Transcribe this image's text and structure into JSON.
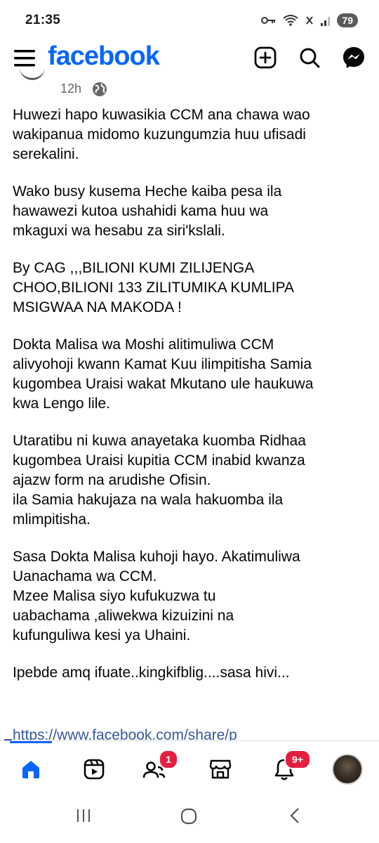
{
  "status_bar": {
    "time": "21:35",
    "battery": "79"
  },
  "header": {
    "brand": "facebook"
  },
  "post": {
    "time": "12h",
    "paragraphs": [
      "Huwezi hapo kuwasikia CCM ana chawa wao\nwakipanua midomo kuzungumzia huu ufisadi\nserekalini.",
      "Wako busy kusema Heche kaiba pesa ila\nhawawezi kutoa ushahidi kama huu wa\nmkaguxi wa hesabu za siri'kslali.",
      "By CAG ,,,BILIONI KUMI ZILIJENGA\nCHOO,BILIONI 133 ZILITUMIKA KUMLIPA\nMSIGWAA NA MAKODA !",
      "Dokta Malisa wa Moshi alitimuliwa CCM\nalivyohoji kwann Kamat Kuu ilimpitisha Samia\nkugombea Uraisi wakat Mkutano ule haukuwa\nkwa Lengo lile.",
      "Utaratibu ni kuwa anayetaka kuomba Ridhaa\nkugombea Uraisi kupitia CCM inabid kwanza\najazw form na arudishe Ofisin.\nila Samia hakujaza na wala hakuomba ila\nmlimpitisha.",
      "Sasa Dokta Malisa kuhoji hayo. Akatimuliwa\nUanachama wa CCM.\nMzee Malisa siyo kufukuzwa tu\nuabachama ,aliwekwa kizuizini na\nkufunguliwa kesi ya Uhaini.",
      "Ipebde amq ifuate..kingkifblig....sasa hivi..."
    ],
    "link": "https://www.facebook.com/share/p"
  },
  "bottom_nav": {
    "friends_badge": "1",
    "notifications_badge": "9+"
  },
  "colors": {
    "brand": "#0866ff",
    "badge": "#e41e3f",
    "link": "#385898"
  }
}
